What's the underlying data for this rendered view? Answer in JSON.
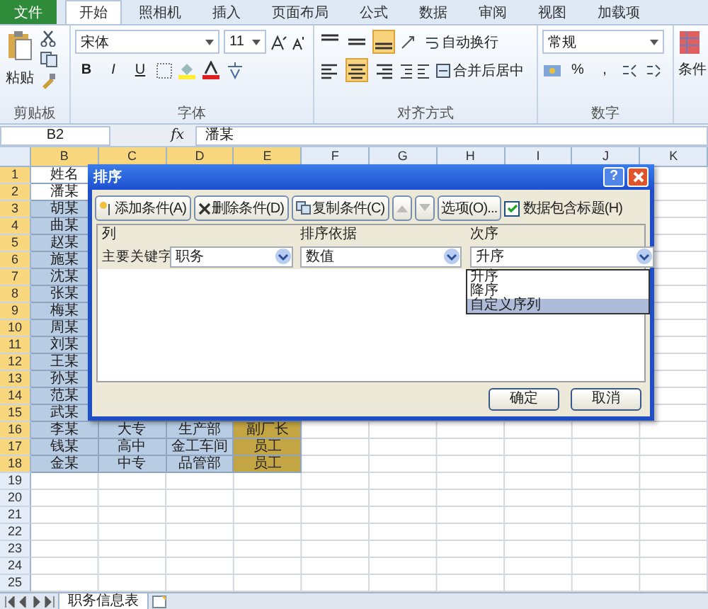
{
  "ribbon": {
    "tabs": [
      {
        "label": "文件",
        "kind": "file",
        "selected": false
      },
      {
        "label": "开始",
        "kind": "tab",
        "selected": true
      },
      {
        "label": "照相机",
        "kind": "tab",
        "selected": false
      },
      {
        "label": "插入",
        "kind": "tab",
        "selected": false
      },
      {
        "label": "页面布局",
        "kind": "tab",
        "selected": false
      },
      {
        "label": "公式",
        "kind": "tab",
        "selected": false
      },
      {
        "label": "数据",
        "kind": "tab",
        "selected": false
      },
      {
        "label": "审阅",
        "kind": "tab",
        "selected": false
      },
      {
        "label": "视图",
        "kind": "tab",
        "selected": false
      },
      {
        "label": "加载项",
        "kind": "tab",
        "selected": false
      }
    ],
    "clipboard": {
      "paste": "粘贴",
      "label": "剪贴板"
    },
    "font": {
      "name": "宋体",
      "size": "11",
      "bold": "B",
      "italic": "I",
      "underline": "U",
      "label": "字体"
    },
    "alignment": {
      "vertical": [
        {
          "kind": "top",
          "selected": false
        },
        {
          "kind": "middle",
          "selected": false
        },
        {
          "kind": "bottom",
          "selected": true
        }
      ],
      "horizontal": [
        {
          "kind": "left",
          "selected": false
        },
        {
          "kind": "center",
          "selected": true
        },
        {
          "kind": "right",
          "selected": false
        }
      ],
      "wrap": "自动换行",
      "merge": "合并后居中",
      "label": "对齐方式"
    },
    "number": {
      "format": "常规",
      "percent": "%",
      "comma": ",",
      "label": "数字"
    },
    "styles": {
      "label": "条件"
    }
  },
  "formula_bar": {
    "name_box": "B2",
    "fx": "fx",
    "value": "潘某"
  },
  "columns": [
    {
      "label": "B",
      "selected": true
    },
    {
      "label": "C",
      "selected": true
    },
    {
      "label": "D",
      "selected": true
    },
    {
      "label": "E",
      "selected": true
    },
    {
      "label": "F",
      "selected": false
    },
    {
      "label": "G",
      "selected": false
    },
    {
      "label": "H",
      "selected": false
    },
    {
      "label": "I",
      "selected": false
    },
    {
      "label": "J",
      "selected": false
    },
    {
      "label": "K",
      "selected": false
    }
  ],
  "rows": [
    {
      "number": "1",
      "selected": true,
      "highlighted": false,
      "cells": [
        "姓名"
      ]
    },
    {
      "number": "2",
      "selected": true,
      "highlighted": false,
      "cells": [
        "潘某"
      ]
    },
    {
      "number": "3",
      "selected": true,
      "highlighted": true,
      "cells": [
        "胡某"
      ]
    },
    {
      "number": "4",
      "selected": true,
      "highlighted": true,
      "cells": [
        "曲某"
      ]
    },
    {
      "number": "5",
      "selected": true,
      "highlighted": true,
      "cells": [
        "赵某"
      ]
    },
    {
      "number": "6",
      "selected": true,
      "highlighted": true,
      "cells": [
        "施某"
      ]
    },
    {
      "number": "7",
      "selected": true,
      "highlighted": true,
      "cells": [
        "沈某"
      ]
    },
    {
      "number": "8",
      "selected": true,
      "highlighted": true,
      "cells": [
        "张某"
      ]
    },
    {
      "number": "9",
      "selected": true,
      "highlighted": true,
      "cells": [
        "梅某"
      ]
    },
    {
      "number": "10",
      "selected": true,
      "highlighted": true,
      "cells": [
        "周某"
      ]
    },
    {
      "number": "11",
      "selected": true,
      "highlighted": true,
      "cells": [
        "刘某"
      ]
    },
    {
      "number": "12",
      "selected": true,
      "highlighted": true,
      "cells": [
        "王某"
      ]
    },
    {
      "number": "13",
      "selected": true,
      "highlighted": true,
      "cells": [
        "孙某"
      ]
    },
    {
      "number": "14",
      "selected": true,
      "highlighted": true,
      "cells": [
        "范某"
      ]
    },
    {
      "number": "15",
      "selected": true,
      "highlighted": true,
      "cells": [
        "武某"
      ]
    },
    {
      "number": "16",
      "selected": true,
      "highlighted": true,
      "cells": [
        "李某",
        "大专",
        "生产部",
        "副厂长"
      ]
    },
    {
      "number": "17",
      "selected": true,
      "highlighted": true,
      "cells": [
        "钱某",
        "高中",
        "金工车间",
        "员工"
      ]
    },
    {
      "number": "18",
      "selected": true,
      "highlighted": true,
      "cells": [
        "金某",
        "中专",
        "品管部",
        "员工"
      ]
    },
    {
      "number": "19",
      "selected": false,
      "highlighted": false,
      "cells": []
    },
    {
      "number": "20",
      "selected": false,
      "highlighted": false,
      "cells": []
    },
    {
      "number": "21",
      "selected": false,
      "highlighted": false,
      "cells": []
    },
    {
      "number": "22",
      "selected": false,
      "highlighted": false,
      "cells": []
    },
    {
      "number": "23",
      "selected": false,
      "highlighted": false,
      "cells": []
    },
    {
      "number": "24",
      "selected": false,
      "highlighted": false,
      "cells": []
    },
    {
      "number": "25",
      "selected": false,
      "highlighted": false,
      "cells": []
    }
  ],
  "sort_dialog": {
    "title": "排序",
    "help": "?",
    "toolbar": [
      {
        "label": "添加条件(A)",
        "kind": "add"
      },
      {
        "label": "删除条件(D)",
        "kind": "delete"
      },
      {
        "label": "复制条件(C)",
        "kind": "copy"
      }
    ],
    "move_up_disabled": true,
    "move_down_disabled": true,
    "options": "选项(O)...",
    "header_checkbox": {
      "label": "数据包含标题(H)",
      "checked": true
    },
    "headers": [
      "列",
      "排序依据",
      "次序"
    ],
    "condition": {
      "label": "主要关键字",
      "column": "职务",
      "sort_on": "数值",
      "order": "升序"
    },
    "order_options": [
      {
        "label": "升序",
        "selected": false
      },
      {
        "label": "降序",
        "selected": false
      },
      {
        "label": "自定义序列",
        "selected": true
      }
    ],
    "ok": "确定",
    "cancel": "取消"
  },
  "sheet_tabs": [
    {
      "label": "职务信息表",
      "selected": true
    }
  ]
}
